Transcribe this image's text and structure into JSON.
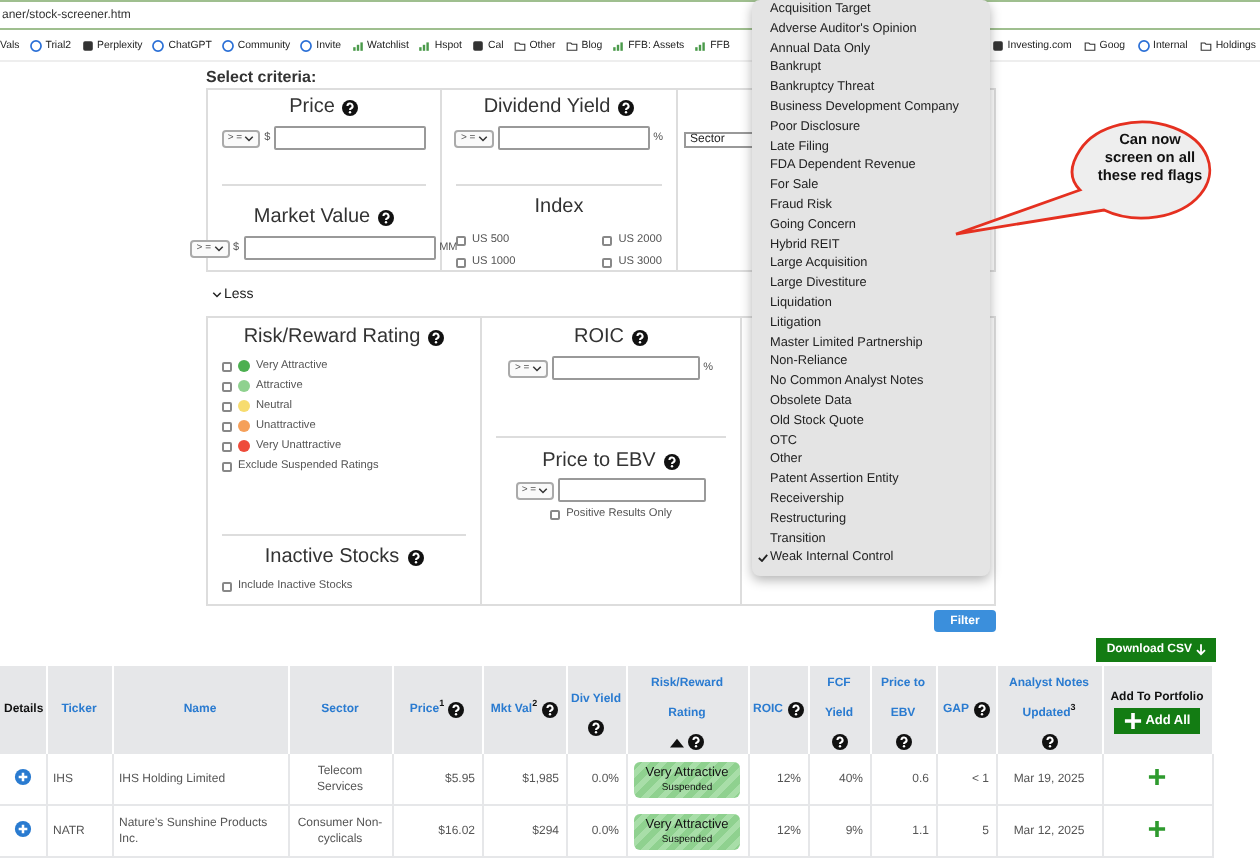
{
  "address_bar": {
    "url": "aner/stock-screener.htm"
  },
  "bookmarks_left": [
    {
      "label": "Vals",
      "kind": "none"
    },
    {
      "label": "Trial2",
      "kind": "globe"
    },
    {
      "label": "Perplexity",
      "kind": "square"
    },
    {
      "label": "ChatGPT",
      "kind": "globe"
    },
    {
      "label": "Community",
      "kind": "globe"
    },
    {
      "label": "Invite",
      "kind": "globe"
    },
    {
      "label": "Watchlist",
      "kind": "chart"
    },
    {
      "label": "Hspot",
      "kind": "chart"
    },
    {
      "label": "Cal",
      "kind": "square"
    },
    {
      "label": "Other",
      "kind": "folder"
    },
    {
      "label": "Blog",
      "kind": "folder"
    },
    {
      "label": "FFB: Assets",
      "kind": "chart"
    },
    {
      "label": "FFB",
      "kind": "chart"
    }
  ],
  "bookmarks_right": [
    {
      "label": "Investing.com",
      "kind": "square"
    },
    {
      "label": "Goog",
      "kind": "folder"
    },
    {
      "label": "Internal",
      "kind": "globe"
    },
    {
      "label": "Holdings",
      "kind": "folder"
    }
  ],
  "criteria_title": "Select criteria:",
  "price": {
    "label": "Price",
    "help": true,
    "operator": "> =",
    "prefix": "$"
  },
  "dividend_yield": {
    "label": "Dividend Yield",
    "help": true,
    "operator": "> =",
    "suffix": "%"
  },
  "sector": {
    "value": "Sector"
  },
  "market_value": {
    "label": "Market Value",
    "help": true,
    "operator": "> =",
    "prefix": "$",
    "suffix": "MM"
  },
  "index": {
    "label": "Index",
    "options": [
      {
        "label": "US 500",
        "checked": false
      },
      {
        "label": "US 2000",
        "checked": false
      },
      {
        "label": "US 1000",
        "checked": false
      },
      {
        "label": "US 3000",
        "checked": false
      }
    ]
  },
  "less_toggle": "Less",
  "risk_reward": {
    "label": "Risk/Reward Rating",
    "help": true,
    "ratings": [
      {
        "label": "Very Attractive",
        "color": "#4caf50",
        "checked": false
      },
      {
        "label": "Attractive",
        "color": "#8fd18f",
        "checked": false
      },
      {
        "label": "Neutral",
        "color": "#f7dc6f",
        "checked": false
      },
      {
        "label": "Unattractive",
        "color": "#f5a05a",
        "checked": false
      },
      {
        "label": "Very Unattractive",
        "color": "#ee4b3a",
        "checked": false
      }
    ],
    "exclude": {
      "label": "Exclude Suspended Ratings",
      "checked": false
    }
  },
  "inactive": {
    "label": "Inactive Stocks",
    "help": true,
    "option": {
      "label": "Include Inactive Stocks",
      "checked": false
    }
  },
  "roic": {
    "label": "ROIC",
    "help": true,
    "operator": "> =",
    "suffix": "%"
  },
  "price_to_ebv": {
    "label": "Price to EBV",
    "help": true,
    "operator": "> =",
    "option": {
      "label": "Positive Results Only",
      "checked": false
    }
  },
  "filter_button": "Filter",
  "download_button": "Download CSV",
  "table": {
    "columns": [
      {
        "label": "Details",
        "help": false,
        "link": false,
        "sorted": false
      },
      {
        "label": "Ticker",
        "help": false,
        "link": true,
        "sorted": false
      },
      {
        "label": "Name",
        "help": false,
        "link": true,
        "sorted": false
      },
      {
        "label": "Sector",
        "help": false,
        "link": true,
        "sorted": false
      },
      {
        "label": "Price$^{1}$",
        "help": true,
        "link": true,
        "sorted": false
      },
      {
        "label": "Mkt Val$^{2}$",
        "help": true,
        "link": true,
        "sorted": false
      },
      {
        "label": "Div Yield",
        "help": true,
        "link": true,
        "sorted": false
      },
      {
        "label": "Risk/Reward Rating",
        "help": true,
        "link": true,
        "sorted": true
      },
      {
        "label": "ROIC",
        "help": true,
        "link": true,
        "sorted": false
      },
      {
        "label": "FCF Yield",
        "help": true,
        "link": true,
        "sorted": false
      },
      {
        "label": "Price to EBV",
        "help": true,
        "link": true,
        "sorted": false
      },
      {
        "label": "GAP",
        "help": true,
        "link": true,
        "sorted": false
      },
      {
        "label": "Analyst Notes Updated$^{3}$",
        "help": true,
        "link": true,
        "sorted": false
      },
      {
        "label": "Add To Portfolio",
        "help": false,
        "link": false,
        "sorted": false
      }
    ],
    "add_all_button": "Add All",
    "rows": [
      {
        "ticker": "IHS",
        "name": "IHS Holding Limited",
        "sector": "Telecom Services",
        "price": "$5.95",
        "mkt_val": "$1,985",
        "div_yield": "0.0%",
        "rating": "Very Attractive",
        "rating_note": "Suspended",
        "roic": "12%",
        "fcf_yield": "40%",
        "price_to_ebv": "0.6",
        "gap": "< 1",
        "updated": "Mar 19, 2025"
      },
      {
        "ticker": "NATR",
        "name": "Nature's Sunshine Products Inc.",
        "sector": "Consumer Non-cyclicals",
        "price": "$16.02",
        "mkt_val": "$294",
        "div_yield": "0.0%",
        "rating": "Very Attractive",
        "rating_note": "Suspended",
        "roic": "12%",
        "fcf_yield": "9%",
        "price_to_ebv": "1.1",
        "gap": "5",
        "updated": "Mar 12, 2025"
      }
    ]
  },
  "red_flags_menu": [
    {
      "label": "Acquisition Target",
      "checked": false
    },
    {
      "label": "Adverse Auditor's Opinion",
      "checked": false
    },
    {
      "label": "Annual Data Only",
      "checked": false
    },
    {
      "label": "Bankrupt",
      "checked": false
    },
    {
      "label": "Bankruptcy Threat",
      "checked": false
    },
    {
      "label": "Business Development Company",
      "checked": false
    },
    {
      "label": "Poor Disclosure",
      "checked": false
    },
    {
      "label": "Late Filing",
      "checked": false
    },
    {
      "label": "FDA Dependent Revenue",
      "checked": false
    },
    {
      "label": "For Sale",
      "checked": false
    },
    {
      "label": "Fraud Risk",
      "checked": false
    },
    {
      "label": "Going Concern",
      "checked": false
    },
    {
      "label": "Hybrid REIT",
      "checked": false
    },
    {
      "label": "Large Acquisition",
      "checked": false
    },
    {
      "label": "Large Divestiture",
      "checked": false
    },
    {
      "label": "Liquidation",
      "checked": false
    },
    {
      "label": "Litigation",
      "checked": false
    },
    {
      "label": "Master Limited Partnership",
      "checked": false
    },
    {
      "label": "Non-Reliance",
      "checked": false
    },
    {
      "label": "No Common Analyst Notes",
      "checked": false
    },
    {
      "label": "Obsolete Data",
      "checked": false
    },
    {
      "label": "Old Stock Quote",
      "checked": false
    },
    {
      "label": "OTC",
      "checked": false
    },
    {
      "label": "Other",
      "checked": false
    },
    {
      "label": "Patent Assertion Entity",
      "checked": false
    },
    {
      "label": "Receivership",
      "checked": false
    },
    {
      "label": "Restructuring",
      "checked": false
    },
    {
      "label": "Transition",
      "checked": false
    },
    {
      "label": "Weak Internal Control",
      "checked": true
    }
  ],
  "callout": "Can now screen on all these red flags"
}
